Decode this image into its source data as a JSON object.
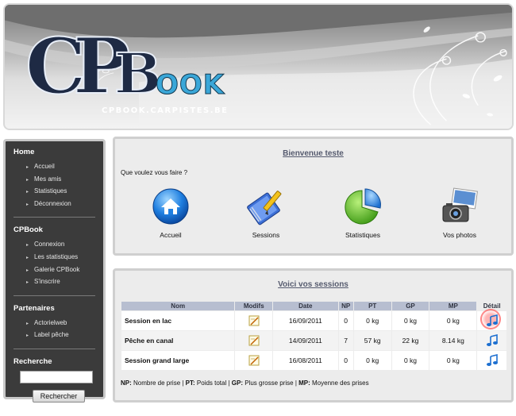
{
  "header": {
    "logo_c": "C",
    "logo_p": "P",
    "logo_b": "B",
    "logo_rest": "OOK",
    "subtitle": "CPBOOK.CARPISTES.BE"
  },
  "sidebar": {
    "home": {
      "title": "Home",
      "items": [
        "Accueil",
        "Mes amis",
        "Statistiques",
        "Déconnexion"
      ]
    },
    "cpbook": {
      "title": "CPBook",
      "items": [
        "Connexion",
        "Les statistiques",
        "Galerie CPBook",
        "S'inscrire"
      ]
    },
    "partners": {
      "title": "Partenaires",
      "items": [
        "Actorielweb",
        "Label pêche"
      ]
    },
    "search": {
      "title": "Recherche",
      "input_value": "",
      "button_label": "Rechercher"
    }
  },
  "welcome": {
    "title": "Bienvenue teste",
    "question": "Que voulez vous faire ?",
    "actions": [
      {
        "label": "Accueil",
        "icon": "home-icon"
      },
      {
        "label": "Sessions",
        "icon": "sessions-icon"
      },
      {
        "label": "Statistiques",
        "icon": "pie-chart-icon"
      },
      {
        "label": "Vos photos",
        "icon": "camera-icon"
      }
    ]
  },
  "sessions": {
    "title": "Voici vos sessions",
    "columns": [
      "Nom",
      "Modifs",
      "Date",
      "NP",
      "PT",
      "GP",
      "MP",
      "Détail"
    ],
    "rows": [
      {
        "nom": "Session en lac",
        "date": "16/09/2011",
        "np": "0",
        "pt": "0 kg",
        "gp": "0 kg",
        "mp": "0 kg"
      },
      {
        "nom": "Pêche en canal",
        "date": "14/09/2011",
        "np": "7",
        "pt": "57 kg",
        "gp": "22 kg",
        "mp": "8.14 kg"
      },
      {
        "nom": "Session grand large",
        "date": "16/08/2011",
        "np": "0",
        "pt": "0 kg",
        "gp": "0 kg",
        "mp": "0 kg"
      }
    ],
    "legend": [
      {
        "abbr": "NP:",
        "text": " Nombre de prise | "
      },
      {
        "abbr": "PT:",
        "text": " Poids total | "
      },
      {
        "abbr": "GP:",
        "text": " Plus grosse prise | "
      },
      {
        "abbr": "MP:",
        "text": " Moyenne des prises"
      }
    ]
  },
  "colors": {
    "sidebar_bg": "#3b3b3b",
    "panel_bg": "#ececec",
    "table_header": "#b7bed0",
    "title_link": "#555a6e"
  }
}
